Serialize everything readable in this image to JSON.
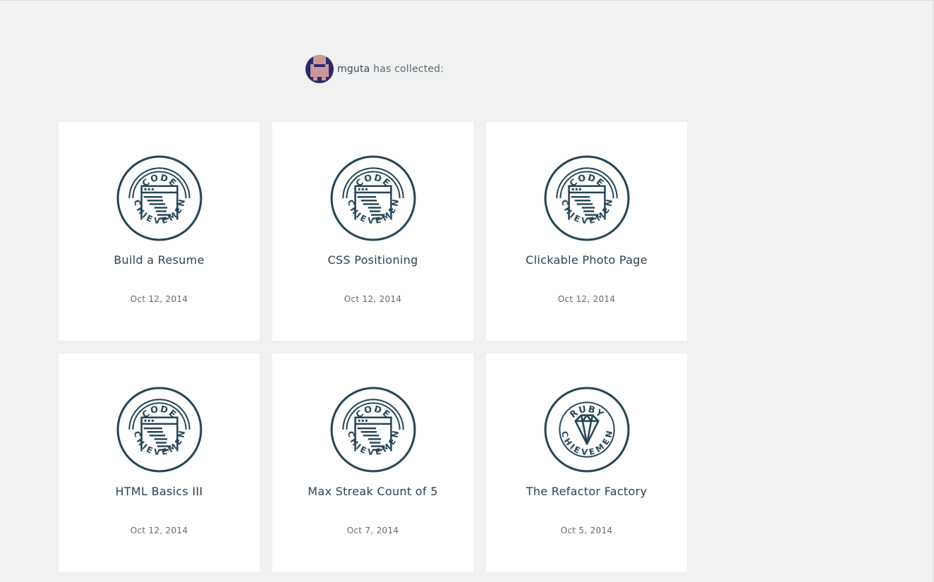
{
  "collector": {
    "username": "mguta",
    "suffix": " has collected:"
  },
  "colors": {
    "badge_stroke": "#254556",
    "background": "#f0f1f1",
    "card_background": "#ffffff",
    "avatar_background": "#2e2a6b",
    "avatar_pixels": "#c9999a"
  },
  "achievements": [
    {
      "title": "Build a Resume",
      "date": "Oct 12, 2014",
      "badge_top": "CODE",
      "badge_bottom": "ACHIEVEMENT",
      "icon": "code-window-icon"
    },
    {
      "title": "CSS Positioning",
      "date": "Oct 12, 2014",
      "badge_top": "CODE",
      "badge_bottom": "ACHIEVEMENT",
      "icon": "code-window-icon"
    },
    {
      "title": "Clickable Photo Page",
      "date": "Oct 12, 2014",
      "badge_top": "CODE",
      "badge_bottom": "ACHIEVEMENT",
      "icon": "code-window-icon"
    },
    {
      "title": "HTML Basics III",
      "date": "Oct 12, 2014",
      "badge_top": "CODE",
      "badge_bottom": "ACHIEVEMENT",
      "icon": "code-window-icon"
    },
    {
      "title": "Max Streak Count of 5",
      "date": "Oct 7, 2014",
      "badge_top": "CODE",
      "badge_bottom": "ACHIEVEMENT",
      "icon": "code-window-icon"
    },
    {
      "title": "The Refactor Factory",
      "date": "Oct 5, 2014",
      "badge_top": "RUBY",
      "badge_bottom": "ACHIEVEMENT",
      "icon": "ruby-gem-icon"
    }
  ]
}
